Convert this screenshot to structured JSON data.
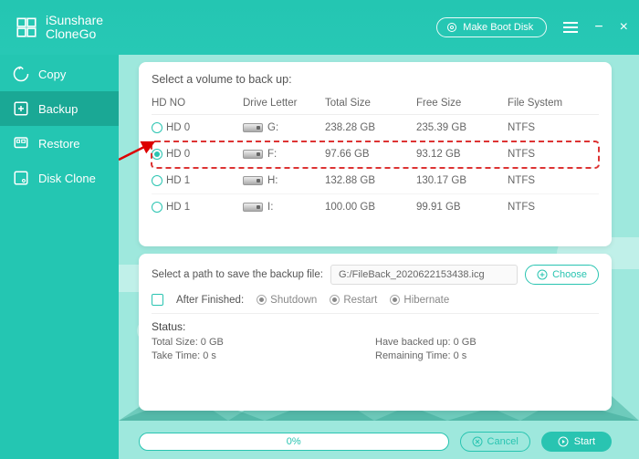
{
  "app": {
    "title_line1": "iSunshare",
    "title_line2": "CloneGo"
  },
  "titlebar": {
    "boot_disk": "Make Boot Disk"
  },
  "sidebar": {
    "items": [
      {
        "label": "Copy"
      },
      {
        "label": "Backup"
      },
      {
        "label": "Restore"
      },
      {
        "label": "Disk Clone"
      }
    ]
  },
  "main": {
    "select_volume_title": "Select a volume to back up:",
    "columns": {
      "c0": "HD NO",
      "c1": "Drive Letter",
      "c2": "Total Size",
      "c3": "Free Size",
      "c4": "File System"
    },
    "rows": [
      {
        "hd": "HD 0",
        "letter": "G:",
        "total": "238.28 GB",
        "free": "235.39 GB",
        "fs": "NTFS",
        "selected": false
      },
      {
        "hd": "HD 0",
        "letter": "F:",
        "total": "97.66 GB",
        "free": "93.12 GB",
        "fs": "NTFS",
        "selected": true
      },
      {
        "hd": "HD 1",
        "letter": "H:",
        "total": "132.88 GB",
        "free": "130.17 GB",
        "fs": "NTFS",
        "selected": false
      },
      {
        "hd": "HD 1",
        "letter": "I:",
        "total": "100.00 GB",
        "free": "99.91 GB",
        "fs": "NTFS",
        "selected": false
      }
    ],
    "path_label": "Select a path to save the backup file:",
    "path_value": "G:/FileBack_2020622153438.icg",
    "choose_label": "Choose",
    "after_label": "After Finished:",
    "after_opts": {
      "shutdown": "Shutdown",
      "restart": "Restart",
      "hibernate": "Hibernate"
    },
    "status": {
      "title": "Status:",
      "total": "Total Size: 0 GB",
      "backed": "Have backed up: 0 GB",
      "take": "Take Time: 0 s",
      "remain": "Remaining Time: 0 s"
    },
    "progress_text": "0%",
    "cancel_label": "Cancel",
    "start_label": "Start"
  }
}
